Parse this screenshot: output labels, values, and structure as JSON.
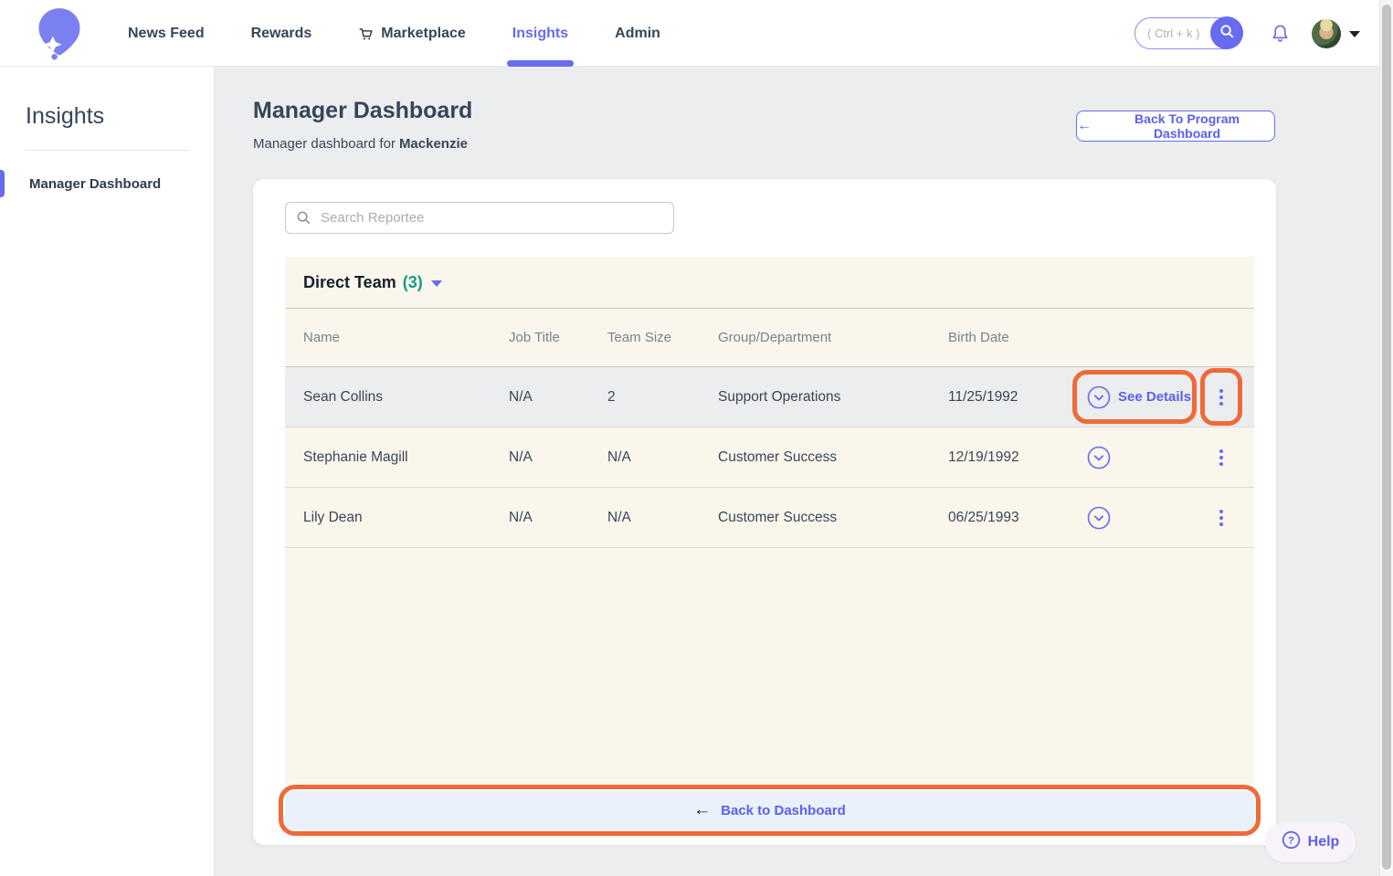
{
  "colors": {
    "accent": "#666BF0",
    "highlight_orange": "#F06A38",
    "count_teal": "#18998B",
    "cream_bg": "#FAF6EC",
    "selected_row_bg": "#EBEDEE",
    "footer_bar_bg": "#E9F1FC",
    "text_navy": "#36455A"
  },
  "topnav": {
    "items": [
      {
        "label": "News Feed"
      },
      {
        "label": "Rewards"
      },
      {
        "label": "Marketplace"
      },
      {
        "label": "Insights"
      },
      {
        "label": "Admin"
      }
    ],
    "search_placeholder": "( Ctrl + k )"
  },
  "sidebar": {
    "title": "Insights",
    "items": [
      {
        "label": "Manager Dashboard"
      }
    ]
  },
  "page": {
    "title": "Manager Dashboard",
    "subtitle_prefix": "Manager dashboard for",
    "subtitle_name": "Mackenzie",
    "back_button_label": "Back To Program Dashboard",
    "back_arrow": "←"
  },
  "panel": {
    "search_placeholder": "Search Reportee",
    "group": {
      "title": "Direct Team",
      "count": "(3)"
    },
    "table": {
      "columns": [
        "Name",
        "Job Title",
        "Team Size",
        "Group/Department",
        "Birth Date"
      ],
      "rows": [
        {
          "name": "Sean Collins",
          "job_title": "N/A",
          "team_size": "2",
          "group": "Support Operations",
          "birth_date": "11/25/1992",
          "details_label": "See Details"
        },
        {
          "name": "Stephanie Magill",
          "job_title": "N/A",
          "team_size": "N/A",
          "group": "Customer Success",
          "birth_date": "12/19/1992"
        },
        {
          "name": "Lily Dean",
          "job_title": "N/A",
          "team_size": "N/A",
          "group": "Customer Success",
          "birth_date": "06/25/1993"
        }
      ]
    },
    "footer": {
      "label": "Back to Dashboard",
      "arrow": "←"
    }
  },
  "help": {
    "label": "Help"
  }
}
